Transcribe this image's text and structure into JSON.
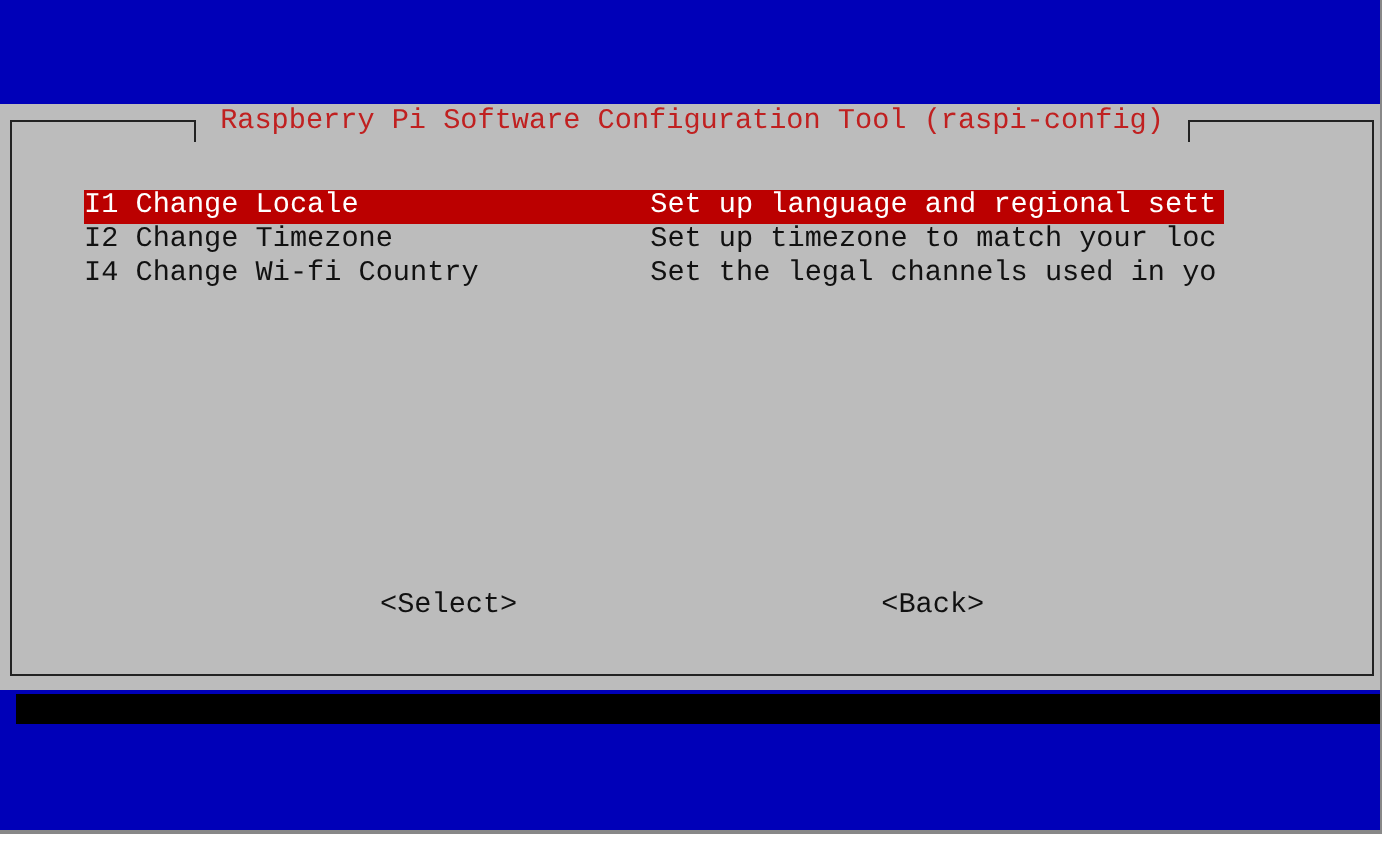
{
  "dialog": {
    "title": "Raspberry Pi Software Configuration Tool (raspi-config)",
    "menu_items": [
      {
        "label": "I1 Change Locale",
        "description": "Set up language and regional sett",
        "selected": true
      },
      {
        "label": "I2 Change Timezone",
        "description": "Set up timezone to match your loc",
        "selected": false
      },
      {
        "label": "I4 Change Wi-fi Country",
        "description": "Set the legal channels used in yo",
        "selected": false
      }
    ],
    "buttons": [
      "<Select>",
      "<Back>"
    ]
  }
}
